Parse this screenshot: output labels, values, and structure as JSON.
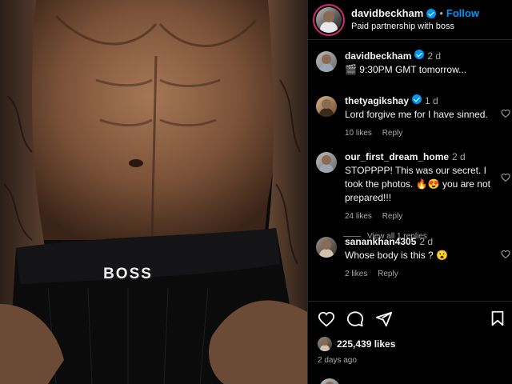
{
  "header": {
    "username": "davidbeckham",
    "follow_label": "Follow",
    "separator": "•",
    "partnership": "Paid partnership with boss"
  },
  "photo": {
    "waistband_text": "BOSS"
  },
  "caption": {
    "username": "davidbeckham",
    "time": "2 d",
    "text": "🎬 9:30PM GMT tomorrow..."
  },
  "comments": [
    {
      "username": "thetyagikshay",
      "verified": true,
      "time": "1 d",
      "text": "Lord forgive me for I have sinned.",
      "likes": "10 likes",
      "reply": "Reply"
    },
    {
      "username": "our_first_dream_home",
      "verified": false,
      "time": "2 d",
      "text": "STOPPPP! This was our secret. I took the photos. 🔥😍 you are not prepared!!!",
      "likes": "24 likes",
      "reply": "Reply",
      "view_replies": "View all 1 replies"
    },
    {
      "username": "sanankhan4305",
      "verified": false,
      "time": "2 d",
      "text": "Whose body is this ? 😮",
      "likes": "2 likes",
      "reply": "Reply"
    }
  ],
  "footer": {
    "likes": "225,439 likes",
    "posted": "2 days ago"
  },
  "icons": [
    "heart-icon",
    "comment-icon",
    "share-icon",
    "bookmark-icon",
    "verified-badge-icon"
  ],
  "colors": {
    "accent": "#0095f6",
    "background": "#000000",
    "muted": "#a8a8a8",
    "story_ring": "#d62976"
  }
}
